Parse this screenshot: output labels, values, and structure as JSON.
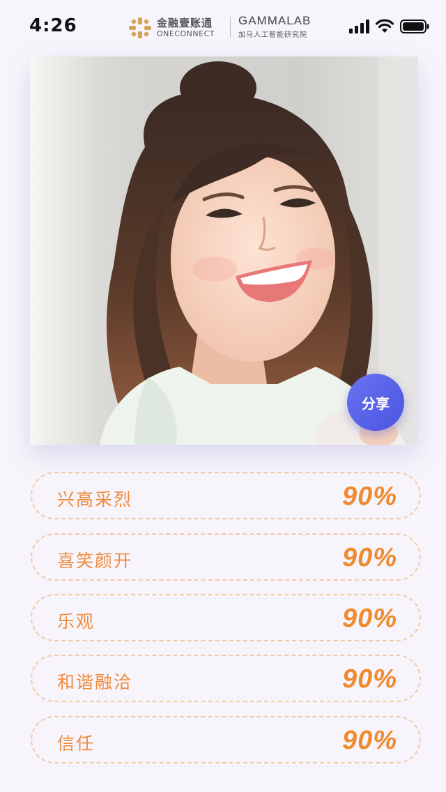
{
  "status_bar": {
    "time": "4:26",
    "brand_cn": "金融壹账通",
    "brand_en": "ONECONNECT",
    "lab_title": "GAMMALAB",
    "lab_subtitle": "加马人工智能研究院",
    "icons": [
      "signal-icon",
      "wifi-icon",
      "battery-icon"
    ]
  },
  "photo": {
    "subject": "smiling-woman-portrait",
    "share_label": "分享"
  },
  "emotions": [
    {
      "label": "兴高采烈",
      "value": "90%"
    },
    {
      "label": "喜笑颜开",
      "value": "90%"
    },
    {
      "label": "乐观",
      "value": "90%"
    },
    {
      "label": "和谐融洽",
      "value": "90%"
    },
    {
      "label": "信任",
      "value": "90%"
    }
  ],
  "colors": {
    "accent_orange": "#f08a2e",
    "share_blue": "#5a63e8",
    "background": "#f7f5fb"
  }
}
